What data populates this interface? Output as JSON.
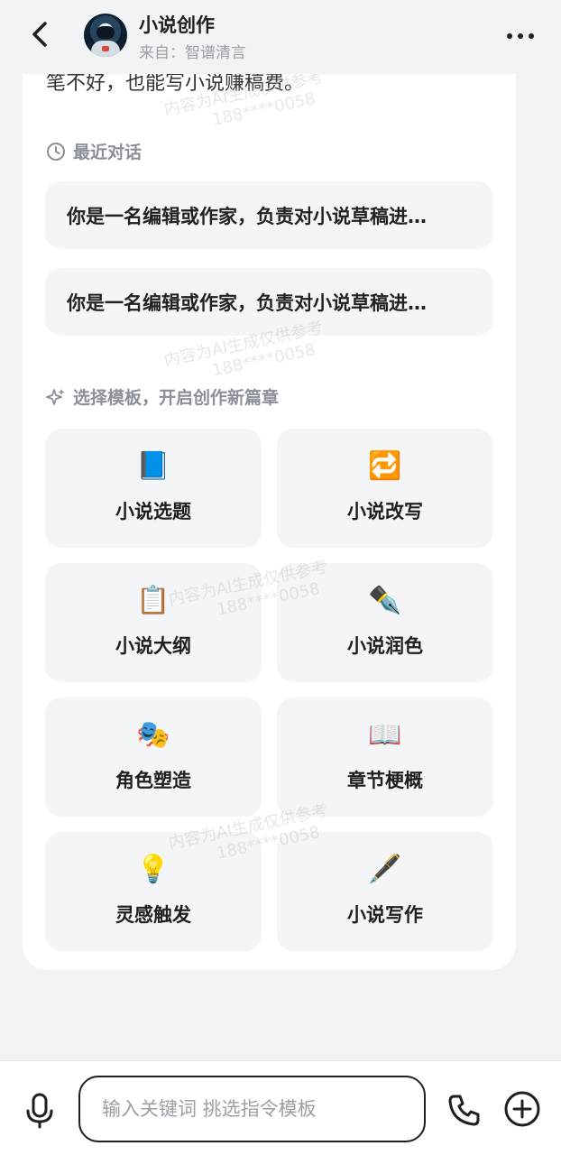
{
  "header": {
    "title": "小说创作",
    "source": "来自：智谱清言"
  },
  "card": {
    "cutoff_text": "笔不好，也能写小说赚稿费。",
    "recent_section_title": "最近对话",
    "recent": [
      {
        "text": "你是一名编辑或作家，负责对小说草稿进…"
      },
      {
        "text": "你是一名编辑或作家，负责对小说草稿进…"
      }
    ],
    "template_section_title": "选择模板，开启创作新篇章",
    "templates": [
      {
        "emoji": "📘",
        "icon": "blue-book-icon",
        "label": "小说选题"
      },
      {
        "emoji": "🔁",
        "icon": "repeat-icon",
        "label": "小说改写"
      },
      {
        "emoji": "📋",
        "icon": "clipboard-icon",
        "label": "小说大纲"
      },
      {
        "emoji": "✒️",
        "icon": "fountain-pen-icon",
        "label": "小说润色"
      },
      {
        "emoji": "🎭",
        "icon": "theater-masks-icon",
        "label": "角色塑造"
      },
      {
        "emoji": "📖",
        "icon": "open-book-icon",
        "label": "章节梗概"
      },
      {
        "emoji": "💡",
        "icon": "light-bulb-icon",
        "label": "灵感触发"
      },
      {
        "emoji": "🖋️",
        "icon": "pen-icon",
        "label": "小说写作"
      }
    ]
  },
  "watermark": {
    "line1": "内容为AI生成仅供参考",
    "line2": "188****0058"
  },
  "bottom": {
    "input_placeholder": "输入关键词 挑选指令模板"
  }
}
